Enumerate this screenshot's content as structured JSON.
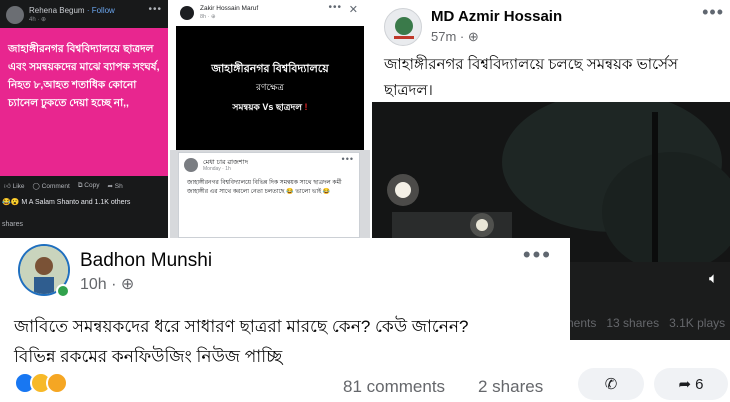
{
  "post_rehena": {
    "author": "Rehena Begum",
    "follow": "· Follow",
    "time": "4h · ",
    "card_text": "জাহাঙ্গীরনগর বিশ্ববিদ্যালয়ে ছাত্রদল এবং সমন্বয়কদের মাঝে ব্যাপক সংঘর্ষ, নিহত ৮,আহত শতাধিক কোনো চ্যানেল ঢুকতে দেয়া হচ্ছে না,,",
    "actions": [
      "Like",
      "Comment",
      "Copy",
      "Sh"
    ],
    "reactions": "M A Salam Shanto and 1.1K others",
    "shares": "shares",
    "card_color": "#e8268f"
  },
  "post_zakir": {
    "author": "Zakir Hossain Maruf",
    "time": "8h · ",
    "card_title": "জাহাঙ্গীরনগর বিশ্ববিদ্যালয়ে",
    "card_sub": "রণক্ষেত্র",
    "card_vs": "সমন্বয়ক Vs ছাত্রদল",
    "card_bang": "!",
    "shared_author": "মেধা চার ৱাজশাদ",
    "shared_time": "Monday · 1h",
    "shared_body": "জাহাঙ্গীরনগর বিশ্ববিদ্যালয়ে বিভিন্ন দিক সমন্বয়ক সাথে ছাত্রদল কর্মী জাহাঙ্গীর এর সাথে করলো নেতা চলতাছে 😂 ভালো ভাই 😂"
  },
  "post_azmir": {
    "author": "MD Azmir Hossain",
    "time": "57m · ",
    "text": "জাহাঙ্গীরনগর বিশ্ববিদ্যালয়ে চলছে সমন্বয়ক ভার্সেস ছাত্রদল।",
    "stats_comments": "nents",
    "stats_shares": "13 shares",
    "stats_plays": "3.1K plays",
    "share_count": "6"
  },
  "post_badhon": {
    "author": "Badhon Munshi",
    "time": "10h · ",
    "text_line1": "জাবিতে সমন্বয়কদের ধরে সাধারণ ছাত্ররা মারছে কেন? কেউ জানেন?",
    "text_line2": "বিভিন্ন রকমের কনফিউজিং নিউজ পাচ্ছি",
    "comments": "81 comments",
    "shares": "2 shares",
    "reaction_icons": [
      "like-reaction-icon",
      "haha-reaction-icon",
      "wow-reaction-icon"
    ]
  }
}
